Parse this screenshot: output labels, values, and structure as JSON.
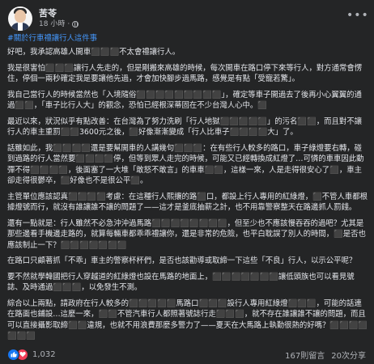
{
  "post": {
    "author": "苦苓",
    "time": "18 小時",
    "hashtag": "#關於行車禮讓行人這件事",
    "hashtag_suffix": "",
    "paragraphs": [
      "好吧，我承認高雄人開車⬛⬛⬛不太會禮讓行人。",
      "我是很害怕⬛⬛⬛讓行人先走的，但是剛搬來高雄的時候，每次開車在路口停下來等行人，對方通常會愣住，停個一兩秒確定我是要讓他先過，才會加快腳步過馬路，感覺是有點「受寵若驚」。",
      "我自己當行人的時候當然也「入境隨俗⬛⬛⬛⬛⬛⬛⬛⬛⬛」，確定等車子開過去了後再小心翼翼的通過⬛⬛，「車子比行人大」的觀念，恐怕已經根深蒂固在不少台灣人心中。⬛",
      "最近以來，狀況似乎有點改善：在台灣為了努力洗刷「行人地獄⬛⬛⬛⬛⬛」的污名⬛⬛，而且對不讓行人的車主重罰⬛⬛3600元之後，⬛好像漸漸變成「行人比車子⬛⬛⬛⬛大」了。",
      "話雖如此，我⬛⬛⬛⬛還是要幫開車的人講幾句⬛⬛⬛：在有些行人較多的路口，車子綠燈要右轉，碰到過路的行人當然要⬛⬛⬛⬛停，但等到眾人走完的時候，可能又已經轉換成紅燈了…可憐的車車因此動彈不得⬛⬛⬛⬛，後面塞了一大堆「敢怒不敢言」的車車⬛⬛，這樣一來，人是走得很安心了⬛，車主卻走得很鬱卒，⬛好像也不是很公平⬛。",
      "主管單位應該認真⬛⬛⬛⬛考慮：在這種行人熙攘的路⬛口，都設上行人專用的紅綠燈，⬛不管人車都根據燈號而行，就沒有誰讓誰不讓的問題了——這才是釜底抽薪之計，也不用靠警察整天在路邊抓人罰錢。",
      "還有一點就是：行人雖然不必急沖沖過馬路⬛⬛⬛⬛⬛⬛⬛⬛，但至少也不應該慢吞吞的過吧？尤其是那些邊看手機邊走路的，就算每輛車都乖乖禮讓你，還是非常的危險，也平白耽誤了別人的時間，⬛是否也應該制止一下？⬛⬛⬛⬛⬛⬛⬛",
      "在路口只顧著抓「不乖」車主的警察杯杯們，是否也該勸導或取締一下這些「不良」行人，以示公平呢？",
      "要不然就學韓國把行人穿越道的紅綠燈也設在馬路的地面上，⬛⬛⬛⬛⬛⬛⬛讓低頭族也可以看見號誌、及時通過⬛⬛⬛，以免發生不測。",
      "綜合以上兩點，請政府在行人較多的⬛⬛⬛⬛⬛馬路口⬛⬛⬛設行人專用紅綠燈⬛⬛⬛，可能的話連在路面也鋪設…這麼一來，⬛⬛不管汽車行人都照著號誌行走⬛⬛⬛，就不存在誰讓誰不讓的問題，而且可以直接攝影取締⬛⬛違規，也就不用浪費那麼多警力了——夏天在大馬路上執勤很熱的好嗎？⬛⬛⬛⬛⬛⬛⬛"
    ]
  },
  "footer": {
    "reaction_count": "1,032",
    "comments": "167則留言",
    "shares": "20次分享"
  },
  "icons": {
    "globe": "globe-icon",
    "more": "more-options-icon",
    "like": "like-reaction-icon",
    "love": "love-reaction-icon"
  },
  "colors": {
    "background": "#242526",
    "text": "#e4e6eb",
    "secondary": "#b0b3b8",
    "hashtag": "#4599ff",
    "like": "#1877f2",
    "love": "#f33e58"
  }
}
